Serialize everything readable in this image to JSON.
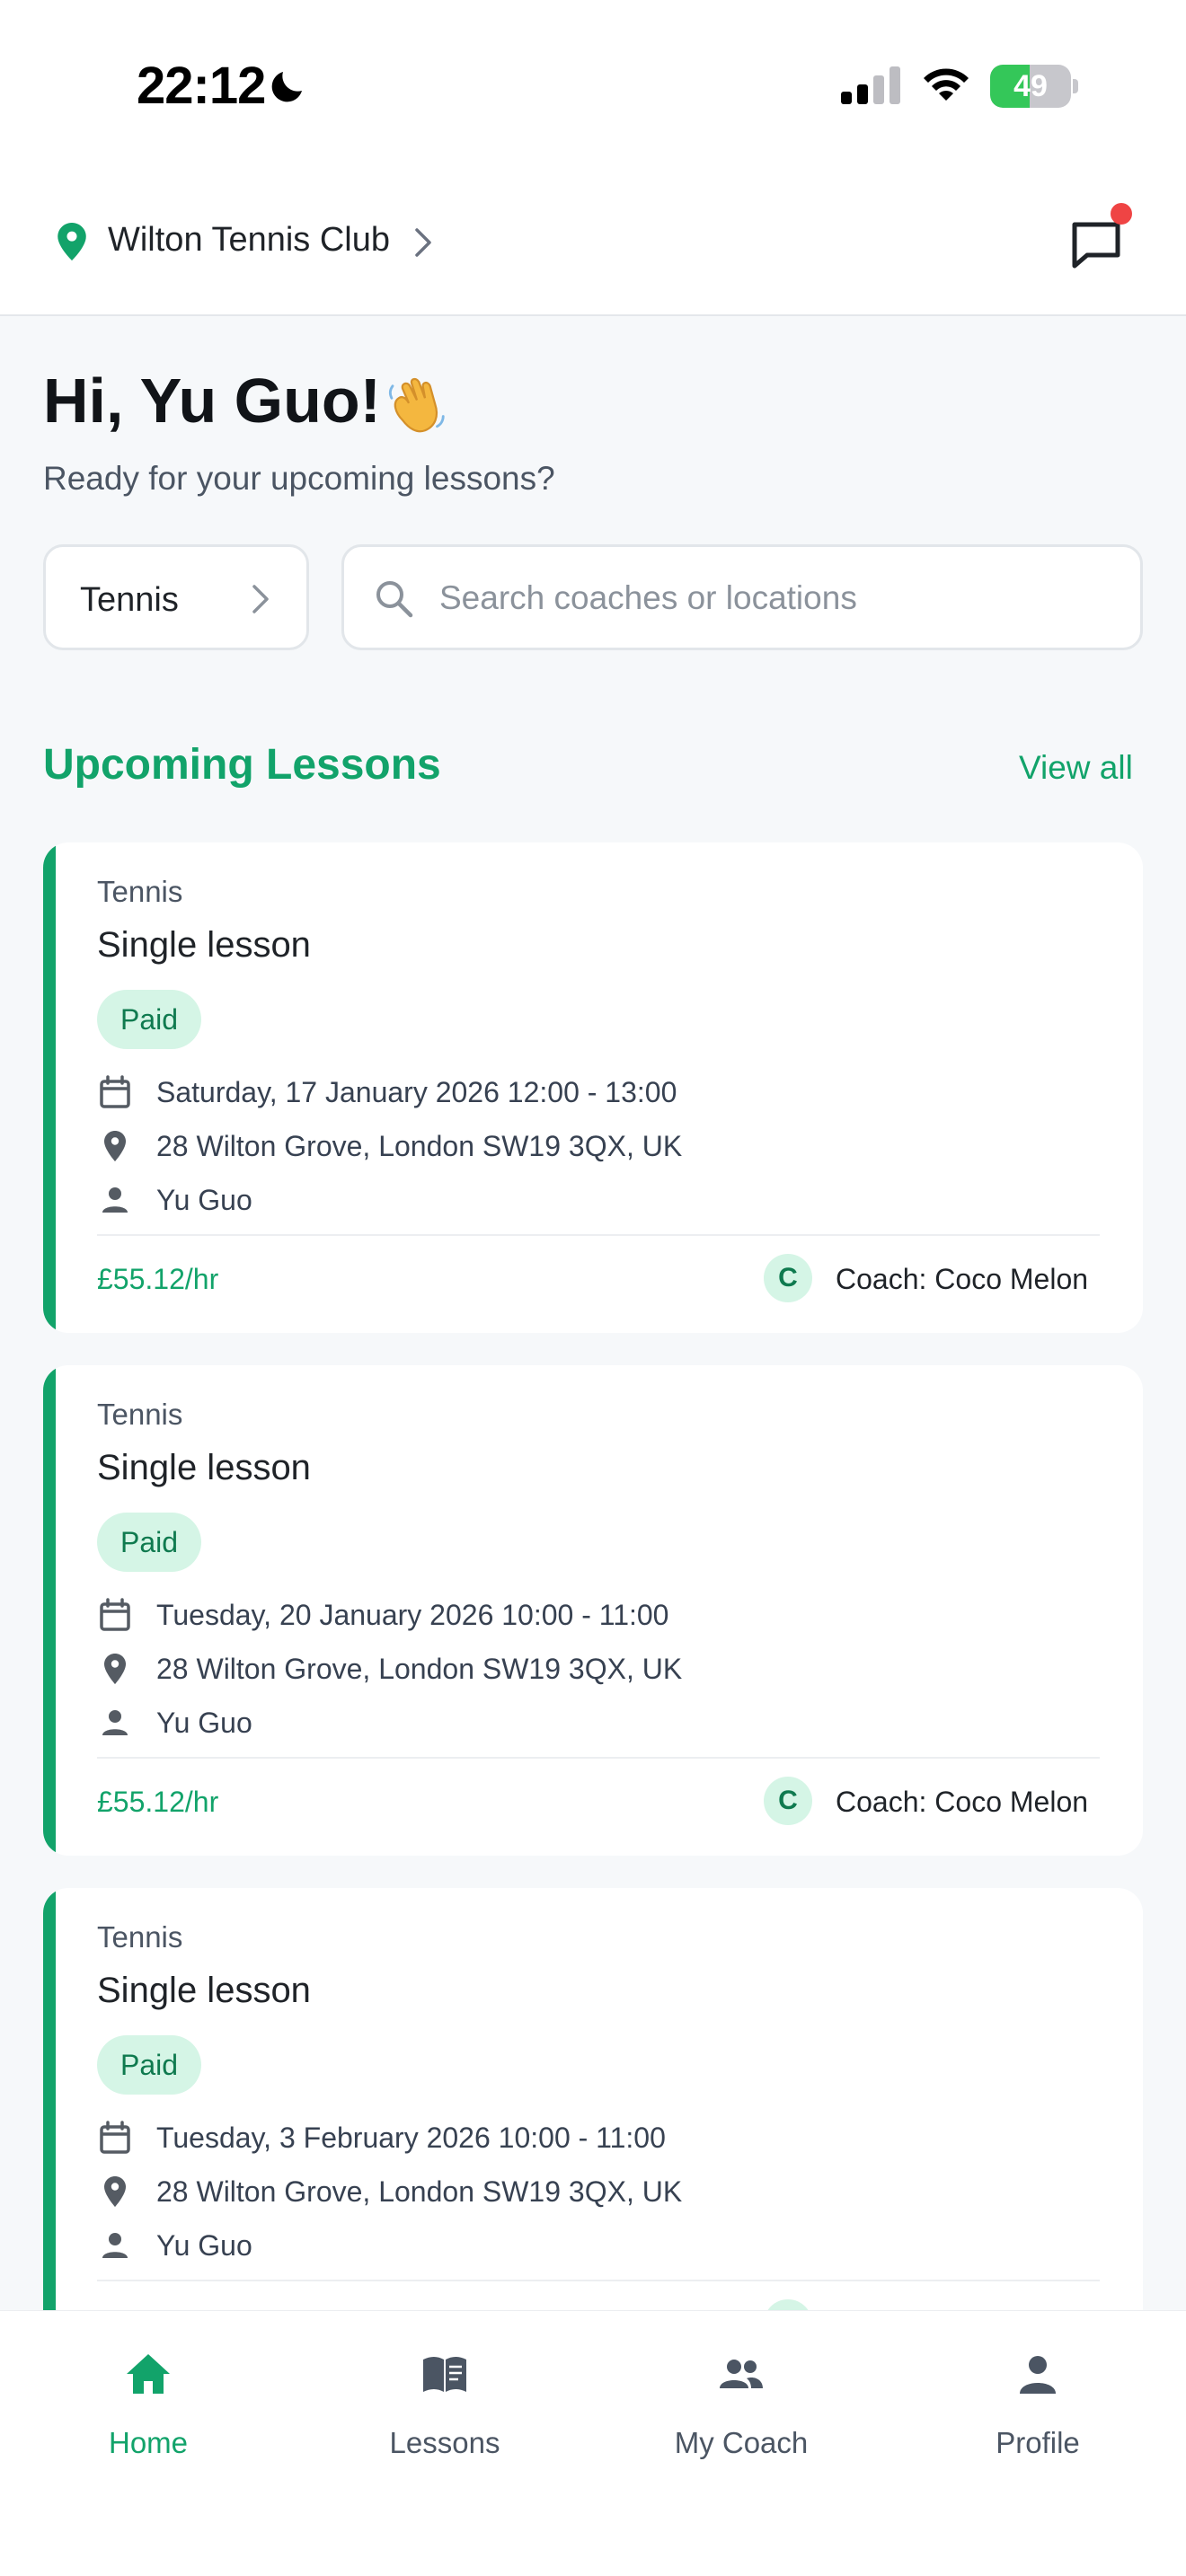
{
  "status_bar": {
    "time": "22:12",
    "battery_percent": 49,
    "battery_label": "49"
  },
  "header": {
    "club_name": "Wilton Tennis Club",
    "has_unread_messages": true
  },
  "greeting": {
    "title": "Hi, Yu Guo!",
    "subtitle": "Ready for your upcoming lessons?"
  },
  "filters": {
    "sport_selected": "Tennis",
    "search_placeholder": "Search coaches or locations",
    "search_value": ""
  },
  "upcoming": {
    "section_title": "Upcoming Lessons",
    "view_all_label": "View all",
    "lessons": [
      {
        "sport": "Tennis",
        "title": "Single lesson",
        "status": "Paid",
        "datetime": "Saturday, 17 January 2026 12:00 - 13:00",
        "location": "28 Wilton Grove, London SW19 3QX, UK",
        "student": "Yu Guo",
        "price": "£55.12/hr",
        "coach_initial": "C",
        "coach": "Coach: Coco Melon"
      },
      {
        "sport": "Tennis",
        "title": "Single lesson",
        "status": "Paid",
        "datetime": "Tuesday, 20 January 2026 10:00 - 11:00",
        "location": "28 Wilton Grove, London SW19 3QX, UK",
        "student": "Yu Guo",
        "price": "£55.12/hr",
        "coach_initial": "C",
        "coach": "Coach: Coco Melon"
      },
      {
        "sport": "Tennis",
        "title": "Single lesson",
        "status": "Paid",
        "datetime": "Tuesday, 3 February 2026 10:00 - 11:00",
        "location": "28 Wilton Grove, London SW19 3QX, UK",
        "student": "Yu Guo"
      }
    ]
  },
  "bottom_nav": {
    "items": [
      {
        "label": "Home",
        "icon": "home-icon",
        "active": true
      },
      {
        "label": "Lessons",
        "icon": "book-icon",
        "active": false
      },
      {
        "label": "My Coach",
        "icon": "people-icon",
        "active": false
      },
      {
        "label": "Profile",
        "icon": "person-icon",
        "active": false
      }
    ]
  },
  "colors": {
    "accent": "#12a36a",
    "badge_bg": "#d5f5e6",
    "notification": "#ef4444",
    "battery": "#34c759"
  }
}
